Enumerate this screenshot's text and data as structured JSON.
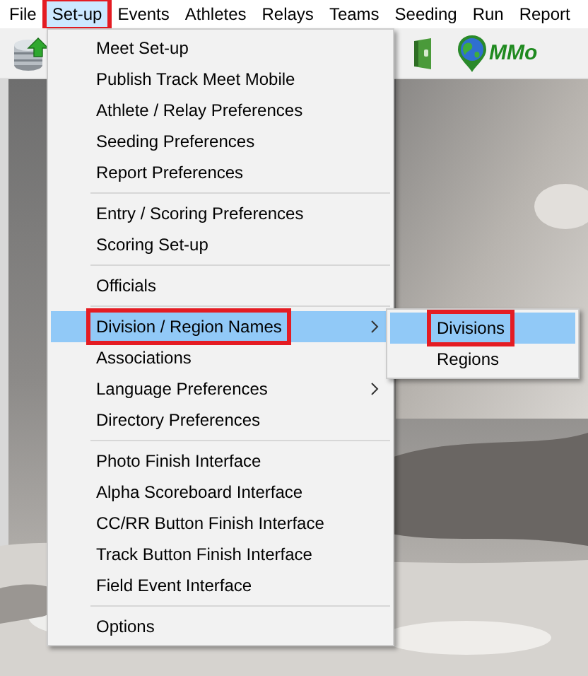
{
  "menubar": [
    {
      "label": "File",
      "selected": false,
      "annotated": false
    },
    {
      "label": "Set-up",
      "selected": true,
      "annotated": true
    },
    {
      "label": "Events",
      "selected": false,
      "annotated": false
    },
    {
      "label": "Athletes",
      "selected": false,
      "annotated": false
    },
    {
      "label": "Relays",
      "selected": false,
      "annotated": false
    },
    {
      "label": "Teams",
      "selected": false,
      "annotated": false
    },
    {
      "label": "Seeding",
      "selected": false,
      "annotated": false
    },
    {
      "label": "Run",
      "selected": false,
      "annotated": false
    },
    {
      "label": "Report",
      "selected": false,
      "annotated": false
    }
  ],
  "toolbar": {
    "mmo_label": "MMo"
  },
  "menu": {
    "items": [
      {
        "kind": "item",
        "label": "Meet Set-up",
        "selected": false,
        "annotated": false,
        "submenu": false
      },
      {
        "kind": "item",
        "label": "Publish Track Meet Mobile",
        "selected": false,
        "annotated": false,
        "submenu": false
      },
      {
        "kind": "item",
        "label": "Athlete / Relay Preferences",
        "selected": false,
        "annotated": false,
        "submenu": false
      },
      {
        "kind": "item",
        "label": "Seeding Preferences",
        "selected": false,
        "annotated": false,
        "submenu": false
      },
      {
        "kind": "item",
        "label": "Report Preferences",
        "selected": false,
        "annotated": false,
        "submenu": false
      },
      {
        "kind": "separator"
      },
      {
        "kind": "item",
        "label": "Entry / Scoring Preferences",
        "selected": false,
        "annotated": false,
        "submenu": false
      },
      {
        "kind": "item",
        "label": "Scoring Set-up",
        "selected": false,
        "annotated": false,
        "submenu": false
      },
      {
        "kind": "separator"
      },
      {
        "kind": "item",
        "label": "Officials",
        "selected": false,
        "annotated": false,
        "submenu": false
      },
      {
        "kind": "separator"
      },
      {
        "kind": "item",
        "label": "Division / Region Names",
        "selected": true,
        "annotated": true,
        "submenu": true
      },
      {
        "kind": "item",
        "label": "Associations",
        "selected": false,
        "annotated": false,
        "submenu": false
      },
      {
        "kind": "item",
        "label": "Language Preferences",
        "selected": false,
        "annotated": false,
        "submenu": true
      },
      {
        "kind": "item",
        "label": "Directory Preferences",
        "selected": false,
        "annotated": false,
        "submenu": false
      },
      {
        "kind": "separator"
      },
      {
        "kind": "item",
        "label": "Photo Finish Interface",
        "selected": false,
        "annotated": false,
        "submenu": false
      },
      {
        "kind": "item",
        "label": "Alpha Scoreboard Interface",
        "selected": false,
        "annotated": false,
        "submenu": false
      },
      {
        "kind": "item",
        "label": "CC/RR Button Finish Interface",
        "selected": false,
        "annotated": false,
        "submenu": false
      },
      {
        "kind": "item",
        "label": "Track Button Finish Interface",
        "selected": false,
        "annotated": false,
        "submenu": false
      },
      {
        "kind": "item",
        "label": "Field Event Interface",
        "selected": false,
        "annotated": false,
        "submenu": false
      },
      {
        "kind": "separator"
      },
      {
        "kind": "item",
        "label": "Options",
        "selected": false,
        "annotated": false,
        "submenu": false
      }
    ]
  },
  "submenu": {
    "items": [
      {
        "kind": "item",
        "label": "Divisions",
        "selected": true,
        "annotated": true,
        "submenu": false
      },
      {
        "kind": "item",
        "label": "Regions",
        "selected": false,
        "annotated": false,
        "submenu": false
      }
    ]
  }
}
